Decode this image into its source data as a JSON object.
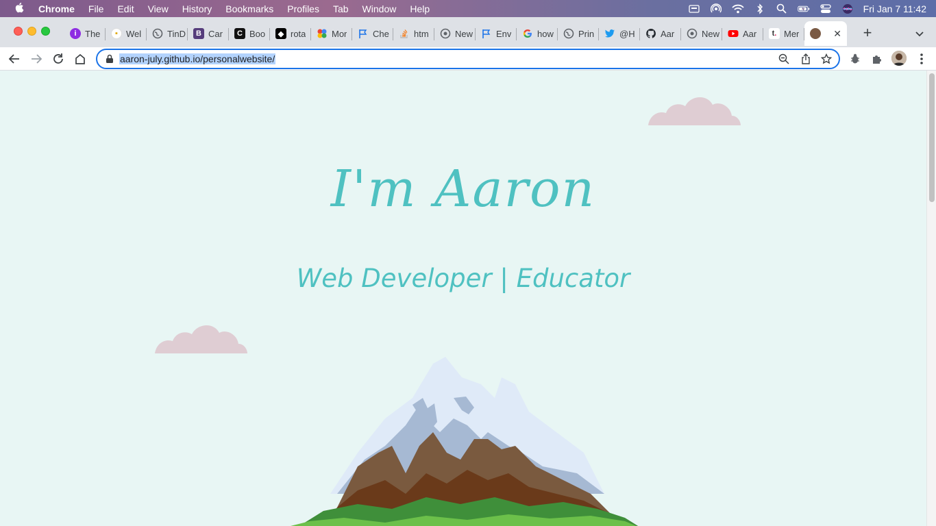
{
  "menubar": {
    "app": "Chrome",
    "items": [
      "File",
      "Edit",
      "View",
      "History",
      "Bookmarks",
      "Profiles",
      "Tab",
      "Window",
      "Help"
    ],
    "clock": "Fri Jan 7  11:42"
  },
  "tabs": [
    {
      "label": "The",
      "icon": "tab-favicon-purple"
    },
    {
      "label": "Wel",
      "icon": "tab-favicon-badge"
    },
    {
      "label": "TinD",
      "icon": "globe-icon"
    },
    {
      "label": "Car",
      "icon": "tab-favicon-b"
    },
    {
      "label": "Boo",
      "icon": "tab-favicon-c"
    },
    {
      "label": "rota",
      "icon": "tab-favicon-codepen"
    },
    {
      "label": "Mor",
      "icon": "tab-favicon-colorful"
    },
    {
      "label": "Che",
      "icon": "flag-icon"
    },
    {
      "label": "htm",
      "icon": "stackoverflow-icon"
    },
    {
      "label": "New",
      "icon": "globe-icon"
    },
    {
      "label": "Env",
      "icon": "flag-icon"
    },
    {
      "label": "how",
      "icon": "google-icon"
    },
    {
      "label": "Prin",
      "icon": "globe-icon"
    },
    {
      "label": "@H",
      "icon": "twitter-icon"
    },
    {
      "label": "Aar",
      "icon": "github-icon"
    },
    {
      "label": "New",
      "icon": "globe-icon"
    },
    {
      "label": "Aar",
      "icon": "youtube-icon"
    },
    {
      "label": "Mer",
      "icon": "tab-favicon-t"
    }
  ],
  "active_tab": {
    "label": "",
    "icon": "profile-favicon"
  },
  "omnibox": {
    "url": "aaron-july.github.io/personalwebsite/"
  },
  "page": {
    "title": "I'm Aaron",
    "subtitle": "Web Developer | Educator"
  },
  "colors": {
    "accent": "#4fc1c1",
    "background": "#e8f6f4",
    "cloud": "#dfcdd3"
  }
}
